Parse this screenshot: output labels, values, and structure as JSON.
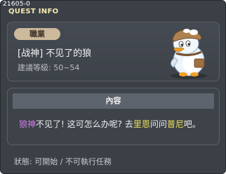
{
  "window": {
    "quest_id": "21605-0",
    "title": "QUEST INFO"
  },
  "quest": {
    "job_badge": "職業",
    "name": "[战神] 不见了的狼",
    "level_requirement": "建議等級: 50~54"
  },
  "content": {
    "header": "內容",
    "segments": {
      "s1": "狼神",
      "s2": "不见了! 这可怎么办呢? 去",
      "s3": "里恩",
      "s4": "问问",
      "s5": "普尼",
      "s6": "吧。"
    }
  },
  "status": {
    "text": "狀態: 可開始 / 不可執行任務"
  },
  "colors": {
    "title": "#f4e9b0",
    "highlight_purple": "#d07ce8",
    "highlight_yellow": "#e8e15a",
    "window_bg": "#3b4047"
  },
  "icons": {
    "npc": "penguin-npc-icon"
  }
}
